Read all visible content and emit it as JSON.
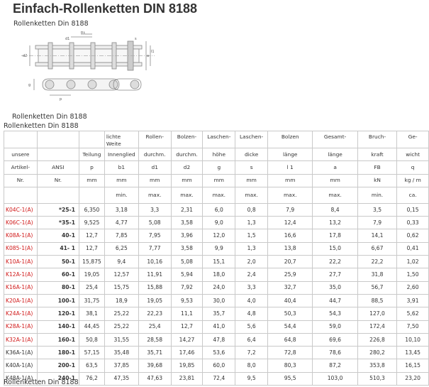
{
  "page": {
    "title": "Einfach-Rollenketten DIN 8188",
    "subtitle": "Rollenketten Din 8188",
    "caption_below_diagram": "Rollenketten Din 8188",
    "table_caption": "Rollenketten Din 8188",
    "footer_caption": "Rollenketten Din 8188"
  },
  "diagram": {
    "dimension_labels": [
      "b1",
      "d1",
      "a",
      "l1",
      "g",
      "d2",
      "p",
      "s"
    ]
  },
  "table": {
    "header_row1": [
      "",
      "",
      "",
      "lichte Weite",
      "Rollen-",
      "Bolzen-",
      "Laschen-",
      "Laschen-",
      "Bolzen",
      "Gesamt-",
      "Bruch-",
      "Ge-"
    ],
    "header_row2": [
      "unsere",
      "",
      "Teilung",
      "Innenglied",
      "durchm.",
      "durchm.",
      "höhe",
      "dicke",
      "länge",
      "länge",
      "kraft",
      "wicht"
    ],
    "header_row3": [
      "Artikel-",
      "ANSI",
      "p",
      "b1",
      "d1",
      "d2",
      "g",
      "s",
      "l 1",
      "a",
      "FB",
      "q"
    ],
    "header_row4": [
      "Nr.",
      "Nr.",
      "mm",
      "mm",
      "mm",
      "mm",
      "mm",
      "mm",
      "mm",
      "mm",
      "kN",
      "kg / m"
    ],
    "header_row5": [
      "",
      "",
      "",
      "min.",
      "max.",
      "max.",
      "max.",
      "max.",
      "max.",
      "max.",
      "min.",
      "ca."
    ],
    "rows": [
      {
        "art": "K04C-1(A)",
        "red": true,
        "ansi": "*25-1",
        "p": "6,350",
        "b1": "3,18",
        "d1": "3,3",
        "d2": "2,31",
        "g": "6,0",
        "s": "0,8",
        "l1": "7,9",
        "a": "8,4",
        "fb": "3,5",
        "q": "0,15"
      },
      {
        "art": "K06C-1(A)",
        "red": true,
        "ansi": "*35-1",
        "p": "9,525",
        "b1": "4,77",
        "d1": "5,08",
        "d2": "3,58",
        "g": "9,0",
        "s": "1,3",
        "l1": "12,4",
        "a": "13,2",
        "fb": "7,9",
        "q": "0,33"
      },
      {
        "art": "K08A-1(A)",
        "red": true,
        "ansi": "40-1",
        "p": "12,7",
        "b1": "7,85",
        "d1": "7,95",
        "d2": "3,96",
        "g": "12,0",
        "s": "1,5",
        "l1": "16,6",
        "a": "17,8",
        "fb": "14,1",
        "q": "0,62"
      },
      {
        "art": "K085-1(A)",
        "red": true,
        "ansi": "41- 1",
        "p": "12,7",
        "b1": "6,25",
        "d1": "7,77",
        "d2": "3,58",
        "g": "9,9",
        "s": "1,3",
        "l1": "13,8",
        "a": "15,0",
        "fb": "6,67",
        "q": "0,41"
      },
      {
        "art": "K10A-1(A)",
        "red": true,
        "ansi": "50-1",
        "p": "15,875",
        "b1": "9,4",
        "d1": "10,16",
        "d2": "5,08",
        "g": "15,1",
        "s": "2,0",
        "l1": "20,7",
        "a": "22,2",
        "fb": "22,2",
        "q": "1,02"
      },
      {
        "art": "K12A-1(A)",
        "red": true,
        "ansi": "60-1",
        "p": "19,05",
        "b1": "12,57",
        "d1": "11,91",
        "d2": "5,94",
        "g": "18,0",
        "s": "2,4",
        "l1": "25,9",
        "a": "27,7",
        "fb": "31,8",
        "q": "1,50"
      },
      {
        "art": "K16A-1(A)",
        "red": true,
        "ansi": "80-1",
        "p": "25,4",
        "b1": "15,75",
        "d1": "15,88",
        "d2": "7,92",
        "g": "24,0",
        "s": "3,3",
        "l1": "32,7",
        "a": "35,0",
        "fb": "56,7",
        "q": "2,60"
      },
      {
        "art": "K20A-1(A)",
        "red": true,
        "ansi": "100-1",
        "p": "31,75",
        "b1": "18,9",
        "d1": "19,05",
        "d2": "9,53",
        "g": "30,0",
        "s": "4,0",
        "l1": "40,4",
        "a": "44,7",
        "fb": "88,5",
        "q": "3,91"
      },
      {
        "art": "K24A-1(A)",
        "red": true,
        "ansi": "120-1",
        "p": "38,1",
        "b1": "25,22",
        "d1": "22,23",
        "d2": "11,1",
        "g": "35,7",
        "s": "4,8",
        "l1": "50,3",
        "a": "54,3",
        "fb": "127,0",
        "q": "5,62"
      },
      {
        "art": "K28A-1(A)",
        "red": true,
        "ansi": "140-1",
        "p": "44,45",
        "b1": "25,22",
        "d1": "25,4",
        "d2": "12,7",
        "g": "41,0",
        "s": "5,6",
        "l1": "54,4",
        "a": "59,0",
        "fb": "172,4",
        "q": "7,50"
      },
      {
        "art": "K32A-1(A)",
        "red": true,
        "ansi": "160-1",
        "p": "50,8",
        "b1": "31,55",
        "d1": "28,58",
        "d2": "14,27",
        "g": "47,8",
        "s": "6,4",
        "l1": "64,8",
        "a": "69,6",
        "fb": "226,8",
        "q": "10,10"
      },
      {
        "art": "K36A-1(A)",
        "red": false,
        "ansi": "180-1",
        "p": "57,15",
        "b1": "35,48",
        "d1": "35,71",
        "d2": "17,46",
        "g": "53,6",
        "s": "7,2",
        "l1": "72,8",
        "a": "78,6",
        "fb": "280,2",
        "q": "13,45"
      },
      {
        "art": "K40A-1(A)",
        "red": false,
        "ansi": "200-1",
        "p": "63,5",
        "b1": "37,85",
        "d1": "39,68",
        "d2": "19,85",
        "g": "60,0",
        "s": "8,0",
        "l1": "80,3",
        "a": "87,2",
        "fb": "353,8",
        "q": "16,15"
      },
      {
        "art": "K48A-1(A)",
        "red": false,
        "ansi": "240-1",
        "p": "76,2",
        "b1": "47,35",
        "d1": "47,63",
        "d2": "23,81",
        "g": "72,4",
        "s": "9,5",
        "l1": "95,5",
        "a": "103,0",
        "fb": "510,3",
        "q": "23,20"
      }
    ]
  },
  "colors": {
    "red_article": "#d01818",
    "border": "#c9c9c9",
    "text": "#333333"
  }
}
